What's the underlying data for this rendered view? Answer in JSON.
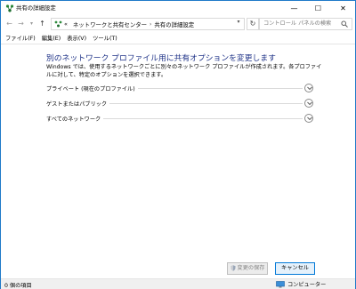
{
  "window": {
    "title": "共有の詳細設定",
    "controls": {
      "minimize": "—",
      "maximize": "☐",
      "close": "✕"
    }
  },
  "address_bar": {
    "back": "←",
    "forward": "→",
    "up": "↑",
    "path_prefix": "«",
    "path": [
      "ネットワークと共有センター",
      "共有の詳細設定"
    ],
    "separator": "›",
    "search_placeholder": "コントロール パネルの検索"
  },
  "menu": [
    "ファイル(F)",
    "編集(E)",
    "表示(V)",
    "ツール(T)"
  ],
  "main": {
    "heading": "別のネットワーク プロファイル用に共有オプションを変更します",
    "description": "Windows では、使用するネットワークごとに別々のネットワーク プロファイルが作成されます。各プロファイルに対して、特定のオプションを選択できます。",
    "profiles": [
      {
        "label": "プライベート (現在のプロファイル)"
      },
      {
        "label": "ゲストまたはパブリック"
      },
      {
        "label": "すべてのネットワーク"
      }
    ]
  },
  "buttons": {
    "save": "変更の保存",
    "cancel": "キャンセル"
  },
  "status": {
    "items": "0 個の項目",
    "location": "コンピューター"
  },
  "colors": {
    "heading": "#1e3287",
    "border": "#1f7ac9",
    "accent": "#0078d7"
  }
}
